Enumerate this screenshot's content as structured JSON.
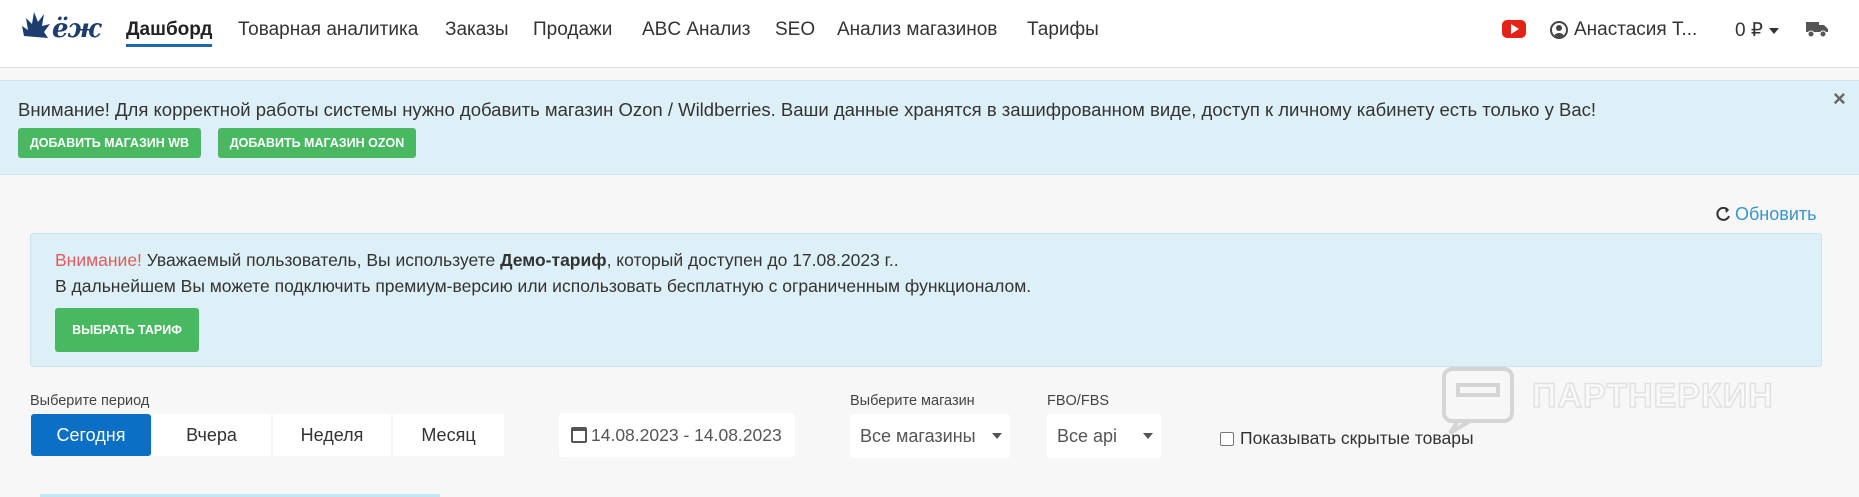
{
  "navbar": {
    "logo_text": "ёж",
    "items": [
      {
        "label": "Дашборд",
        "active": true
      },
      {
        "label": "Товарная аналитика",
        "active": false
      },
      {
        "label": "Заказы",
        "active": false
      },
      {
        "label": "Продажи",
        "active": false
      },
      {
        "label": "ABC Анализ",
        "active": false
      },
      {
        "label": "SEO",
        "active": false
      },
      {
        "label": "Анализ магазинов",
        "active": false
      },
      {
        "label": "Тарифы",
        "active": false
      }
    ],
    "youtube_icon": "youtube-icon",
    "user_name": "Анастасия Т...",
    "balance": "0 ₽",
    "truck_icon": "truck-icon"
  },
  "alert_top": {
    "message": "Внимание! Для корректной работы системы нужно добавить магазин Ozon / Wildberries. Ваши данные хранятся в зашифрованном виде, доступ к личному кабинету есть только у Вас!",
    "close_label": "×",
    "add_wb_label": "ДОБАВИТЬ МАГАЗИН WB",
    "add_ozon_label": "ДОБАВИТЬ МАГАЗИН OZON"
  },
  "refresh_label": "Обновить",
  "demo_alert": {
    "warning": "Внимание!",
    "text_before": " Уважаемый пользователь, Вы используете ",
    "tariff_name": "Демо-тариф",
    "text_after": ", который доступен до 17.08.2023 г..",
    "line2": "В дальнейшем Вы можете подключить премиум-версию или использовать бесплатную с ограниченным функционалом.",
    "button_label": "ВЫБРАТЬ ТАРИФ"
  },
  "filters": {
    "period_label": "Выберите период",
    "periods": [
      {
        "label": "Сегодня",
        "active": true
      },
      {
        "label": "Вчера",
        "active": false
      },
      {
        "label": "Неделя",
        "active": false
      },
      {
        "label": "Месяц",
        "active": false
      }
    ],
    "date_range": "14.08.2023 - 14.08.2023",
    "shop_label": "Выберите магазин",
    "shop_value": "Все магазины",
    "fbo_label": "FBO/FBS",
    "fbo_value": "Все api",
    "hidden_label": "Показывать скрытые товары"
  },
  "watermark_text": "ПАРТНЕРКИН",
  "colors": {
    "accent_blue": "#0b6fc6",
    "green": "#48b861",
    "alert_bg": "#def0f7",
    "warning_red": "#e15b5b",
    "link_blue": "#3b95c6"
  }
}
